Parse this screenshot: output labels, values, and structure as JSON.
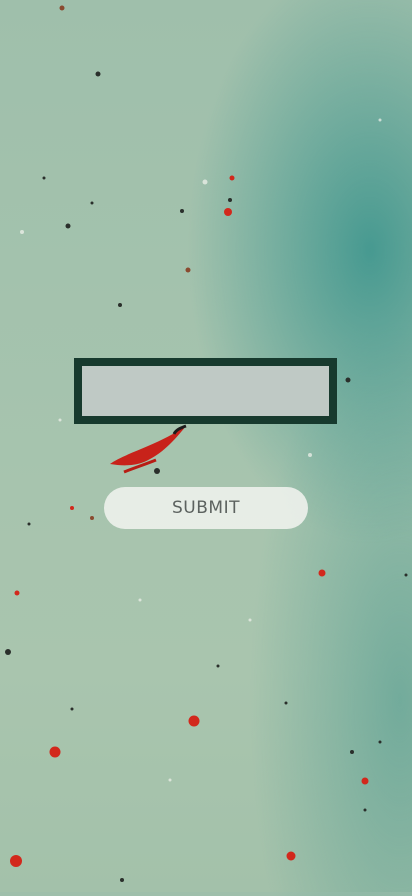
{
  "form": {
    "input": {
      "value": "",
      "placeholder": ""
    },
    "submit_label": "SUBMIT"
  },
  "colors": {
    "input_border": "#173a2e",
    "input_fill": "#bfc9c5",
    "button_fill": "#f0f2ee",
    "button_text": "#5c625f",
    "background_teal": "#2f8c86",
    "background_sage": "#a7c4ae"
  }
}
